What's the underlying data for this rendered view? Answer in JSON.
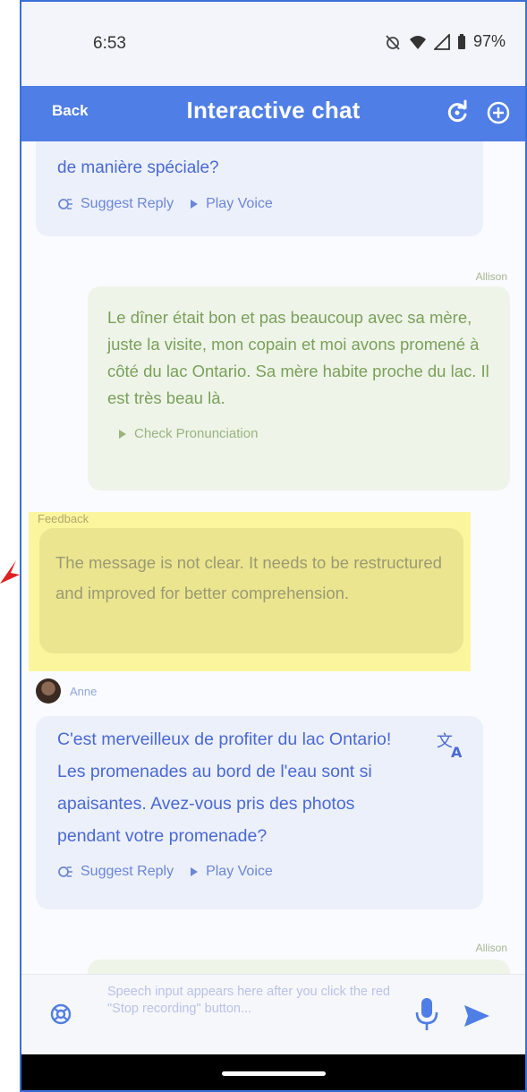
{
  "status_bar": {
    "time": "6:53",
    "battery": "97%"
  },
  "app_bar": {
    "back_label": "Back",
    "title": "Interactive chat"
  },
  "messages": {
    "tutor_prev": {
      "text_tail": "de manière spéciale?",
      "suggest_label": "Suggest Reply",
      "play_label": "Play Voice"
    },
    "user_msg": {
      "sender": "Allison",
      "text": "Le dîner était bon et pas beaucoup avec sa mère, juste la visite, mon copain et moi avons promené à côté du lac Ontario. Sa mère habite proche du lac. Il est très beau là.",
      "pronunciation_label": "Check Pronunciation"
    },
    "feedback": {
      "label": "Feedback",
      "text": "The message is not clear. It needs to be restructured and improved for better comprehension."
    },
    "tutor_reply": {
      "sender": "Anne",
      "text": "C'est merveilleux de profiter du lac Ontario! Les promenades au bord de l'eau sont si apaisantes. Avez-vous pris des photos pendant votre promenade?",
      "suggest_label": "Suggest Reply",
      "play_label": "Play Voice"
    },
    "user_next": {
      "sender": "Allison"
    }
  },
  "input_bar": {
    "placeholder": "Speech input appears here after you click the red \"Stop recording\" button..."
  },
  "colors": {
    "app_bar": "#4f7ee6",
    "tutor_bubble": "#ecf0fa",
    "user_bubble": "#eef4e8",
    "feedback_highlight": "#fbf59e",
    "annotation_arrow": "#e02020"
  }
}
